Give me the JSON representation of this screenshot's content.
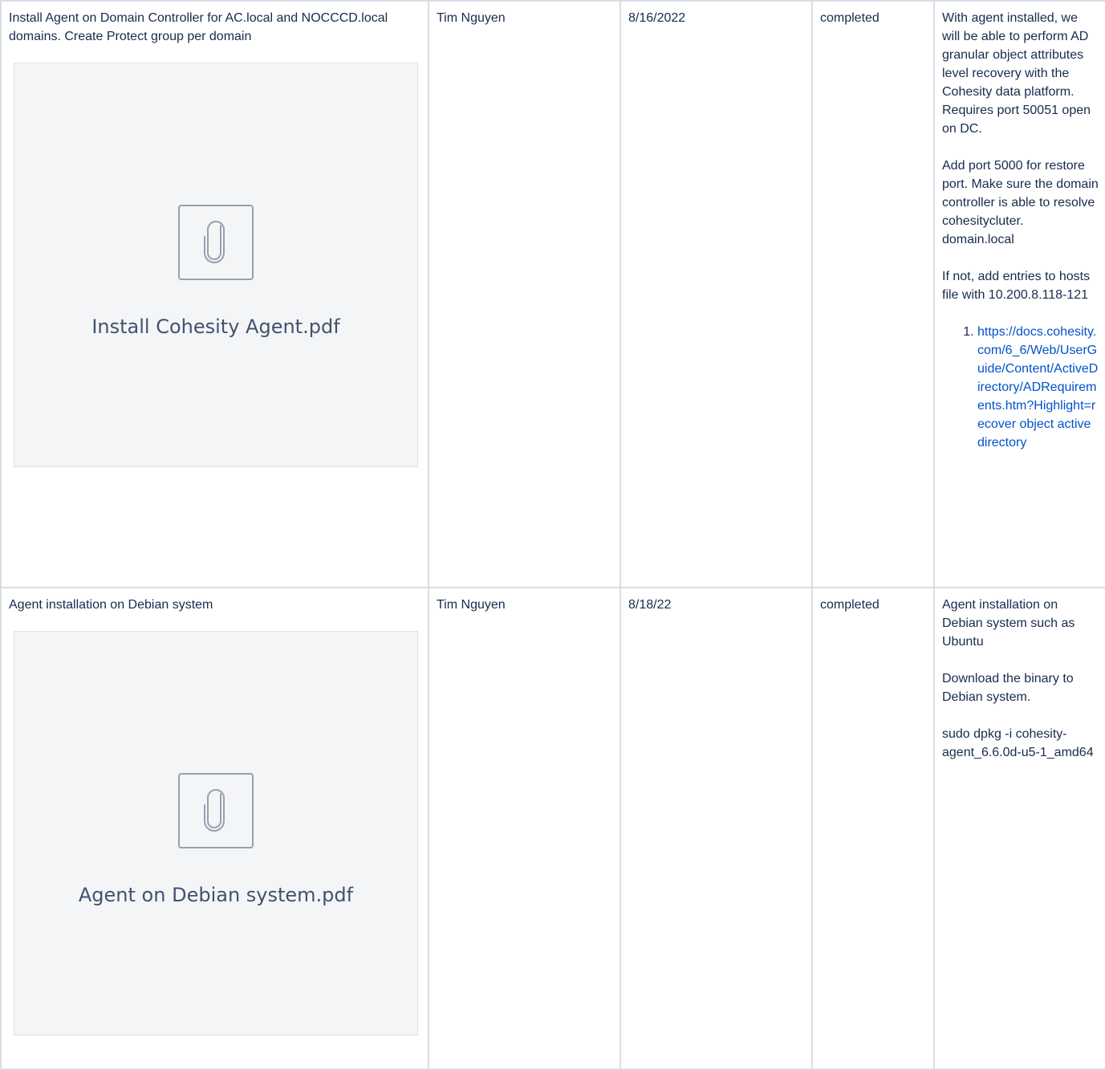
{
  "rows": [
    {
      "task": "Install Agent on Domain Controller for AC.local and NOCCCD.local domains. Create Protect group per domain",
      "attachment": {
        "icon": "paperclip-icon",
        "filename": "Install Cohesity Agent.pdf"
      },
      "owner": "Tim Nguyen",
      "date": "8/16/2022",
      "status": "completed",
      "notes": {
        "p1": "With agent installed, we will be able to perform AD granular object attributes level recovery with the Cohesity data platform. Requires port 50051 open on DC.",
        "p2": "Add port 5000 for restore port. Make sure the domain controller is able to resolve cohesitycluter. domain.local",
        "p3": "If not, add entries to hosts file with 10.200.8.118-121",
        "link": "https://docs.cohesity.com/6_6/Web/UserGuide/Content/ActiveDirectory/ADRequirements.htm?Highlight=recover object active directory"
      }
    },
    {
      "task": "Agent installation on Debian system",
      "attachment": {
        "icon": "paperclip-icon",
        "filename": "Agent on Debian system.pdf"
      },
      "owner": "Tim Nguyen",
      "date": "8/18/22",
      "status": "completed",
      "notes": {
        "p1": "Agent installation on Debian system such as Ubuntu",
        "p2": "Download the binary to Debian system.",
        "p3": "sudo dpkg -i cohesity-agent_6.6.0d-u5-1_amd64"
      }
    }
  ]
}
